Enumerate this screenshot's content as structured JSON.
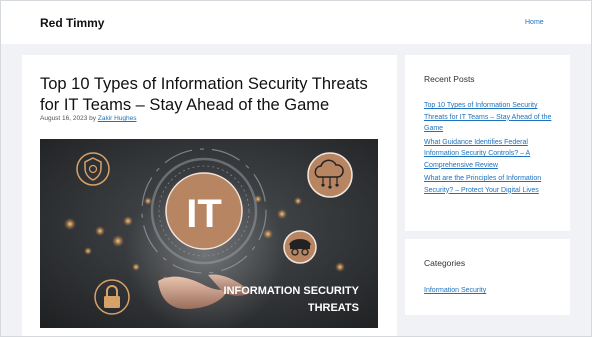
{
  "site": {
    "title": "Red Timmy"
  },
  "nav": {
    "home": "Home"
  },
  "post": {
    "title": "Top 10 Types of Information Security Threats for IT Teams – Stay Ahead of the Game",
    "date": "August 16, 2023",
    "by": "by",
    "author": "Zakir Hughes",
    "image": {
      "center_text": "IT",
      "caption_line1": "INFORMATION SECURITY",
      "caption_line2": "THREATS"
    }
  },
  "sidebar": {
    "recent_posts": {
      "title": "Recent Posts",
      "items": [
        "Top 10 Types of Information Security Threats for IT Teams – Stay Ahead of the Game",
        "What Guidance Identifies Federal Information Security Controls? – A Comprehensive Review",
        "What are the Principles of Information Security? – Protect Your Digital Lives"
      ]
    },
    "categories": {
      "title": "Categories",
      "items": [
        "Information Security"
      ]
    }
  },
  "colors": {
    "link": "#1e72bd",
    "page_background": "#f0f2f5",
    "badge": "#b88563",
    "image_background": "#2a2d2f"
  },
  "icons": [
    "shield-icon",
    "cloud-network-icon",
    "hacker-icon",
    "padlock-icon"
  ]
}
